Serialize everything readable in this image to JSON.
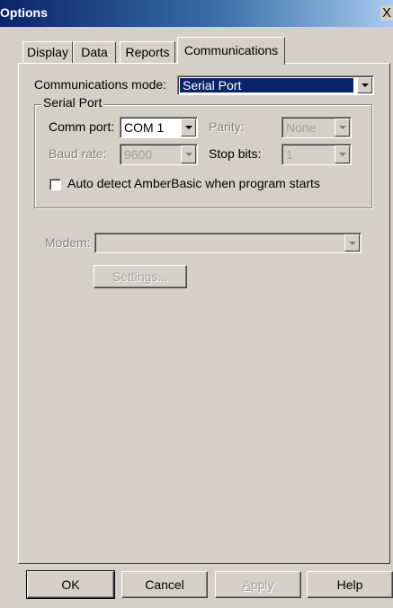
{
  "window": {
    "title": "Options",
    "close_glyph": "X"
  },
  "tabs": [
    {
      "label": "Display",
      "active": false
    },
    {
      "label": "Data",
      "active": false
    },
    {
      "label": "Reports",
      "active": false
    },
    {
      "label": "Communications",
      "active": true
    }
  ],
  "communications": {
    "mode_label": "Communications mode:",
    "mode_value": "Serial Port",
    "serial_port": {
      "group_label": "Serial Port",
      "comm_port_label": "Comm port:",
      "comm_port_value": "COM 1",
      "parity_label": "Parity:",
      "parity_value": "None",
      "baud_rate_label": "Baud rate:",
      "baud_rate_value": "9600",
      "stop_bits_label": "Stop bits:",
      "stop_bits_value": "1",
      "auto_detect_label": "Auto detect AmberBasic when program starts",
      "auto_detect_checked": false
    },
    "modem_label": "Modem:",
    "modem_value": "",
    "settings_button": "Settings..."
  },
  "buttons": {
    "ok": "OK",
    "cancel": "Cancel",
    "apply": "Apply",
    "help": "Help"
  },
  "icons": {
    "close": "close-icon",
    "dropdown": "chevron-down-icon"
  }
}
